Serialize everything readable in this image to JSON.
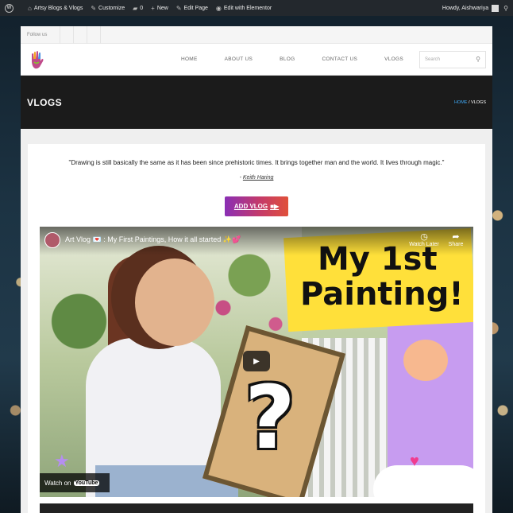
{
  "admin_bar": {
    "site_name": "Artsy Blogs & Vlogs",
    "customize": "Customize",
    "comments_count": "0",
    "new_label": "New",
    "edit_page": "Edit Page",
    "edit_elementor": "Edit with Elementor",
    "howdy": "Howdy, Aishwariya"
  },
  "follow_bar": {
    "label": "Follow us"
  },
  "nav": {
    "items": [
      "HOME",
      "ABOUT US",
      "BLOG",
      "CONTACT US",
      "VLOGS"
    ],
    "search_placeholder": "Search"
  },
  "page_title": "VLOGS",
  "breadcrumb": {
    "home": "HOME",
    "separator": "/",
    "current": "VLOGS"
  },
  "quote": {
    "text": "\"Drawing is still basically the same as it has been since prehistoric times. It brings together man and the world. It lives through magic.\"",
    "author_prefix": "- ",
    "author": "Keith Haring"
  },
  "add_vlog_button": "ADD VLOG",
  "video": {
    "title": "Art Vlog 💌 : My First Paintings, How it all started ✨💕",
    "thumbnail_line1": "My 1st",
    "thumbnail_line2": "Painting!",
    "watch_later": "Watch Later",
    "share": "Share",
    "watch_on": "Watch on",
    "youtube": "YouTube"
  },
  "colors": {
    "admin_bar": "#23282d",
    "title_bar": "#1b1b1b",
    "breadcrumb_home": "#3fa9f5",
    "button_gradient_start": "#8a2fb5",
    "button_gradient_end": "#e0503a"
  }
}
